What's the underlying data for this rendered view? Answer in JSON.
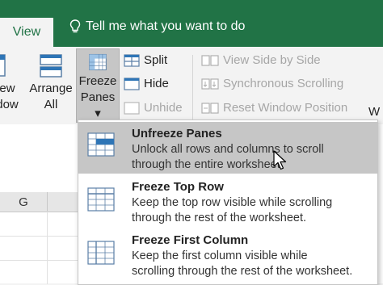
{
  "tabs": {
    "view": "View"
  },
  "tellme": {
    "text": "Tell me what you want to do",
    "icon": "lightbulb-icon"
  },
  "ribbon": {
    "new_window": {
      "line1": "ew",
      "line2": "dow"
    },
    "arrange_all": {
      "line1": "Arrange",
      "line2": "All"
    },
    "freeze_panes": {
      "line1": "Freeze",
      "line2": "Panes ▾"
    },
    "split": "Split",
    "hide": "Hide",
    "unhide": "Unhide",
    "view_side_by_side": "View Side by Side",
    "synchronous_scrolling": "Synchronous Scrolling",
    "reset_window_position": "Reset Window Position",
    "cut_off_w": "W"
  },
  "sheet": {
    "column_g": "G"
  },
  "menu": {
    "items": [
      {
        "title": "Unfreeze Panes",
        "line1": "Unlock all rows and columns to scroll",
        "line2": "through the entire worksheet.",
        "highlighted": true
      },
      {
        "title": "Freeze Top Row",
        "line1": "Keep the top row visible while scrolling",
        "line2": "through the rest of the worksheet.",
        "highlighted": false
      },
      {
        "title": "Freeze First Column",
        "line1": "Keep the first column visible while",
        "line2": "scrolling through the rest of the worksheet.",
        "highlighted": false
      }
    ]
  },
  "colors": {
    "excel_green": "#217346",
    "ribbon_bg": "#f3f3f3",
    "highlight": "#c6c6c6",
    "disabled": "#a6a6a6",
    "icon_blue": "#2e75b6"
  }
}
